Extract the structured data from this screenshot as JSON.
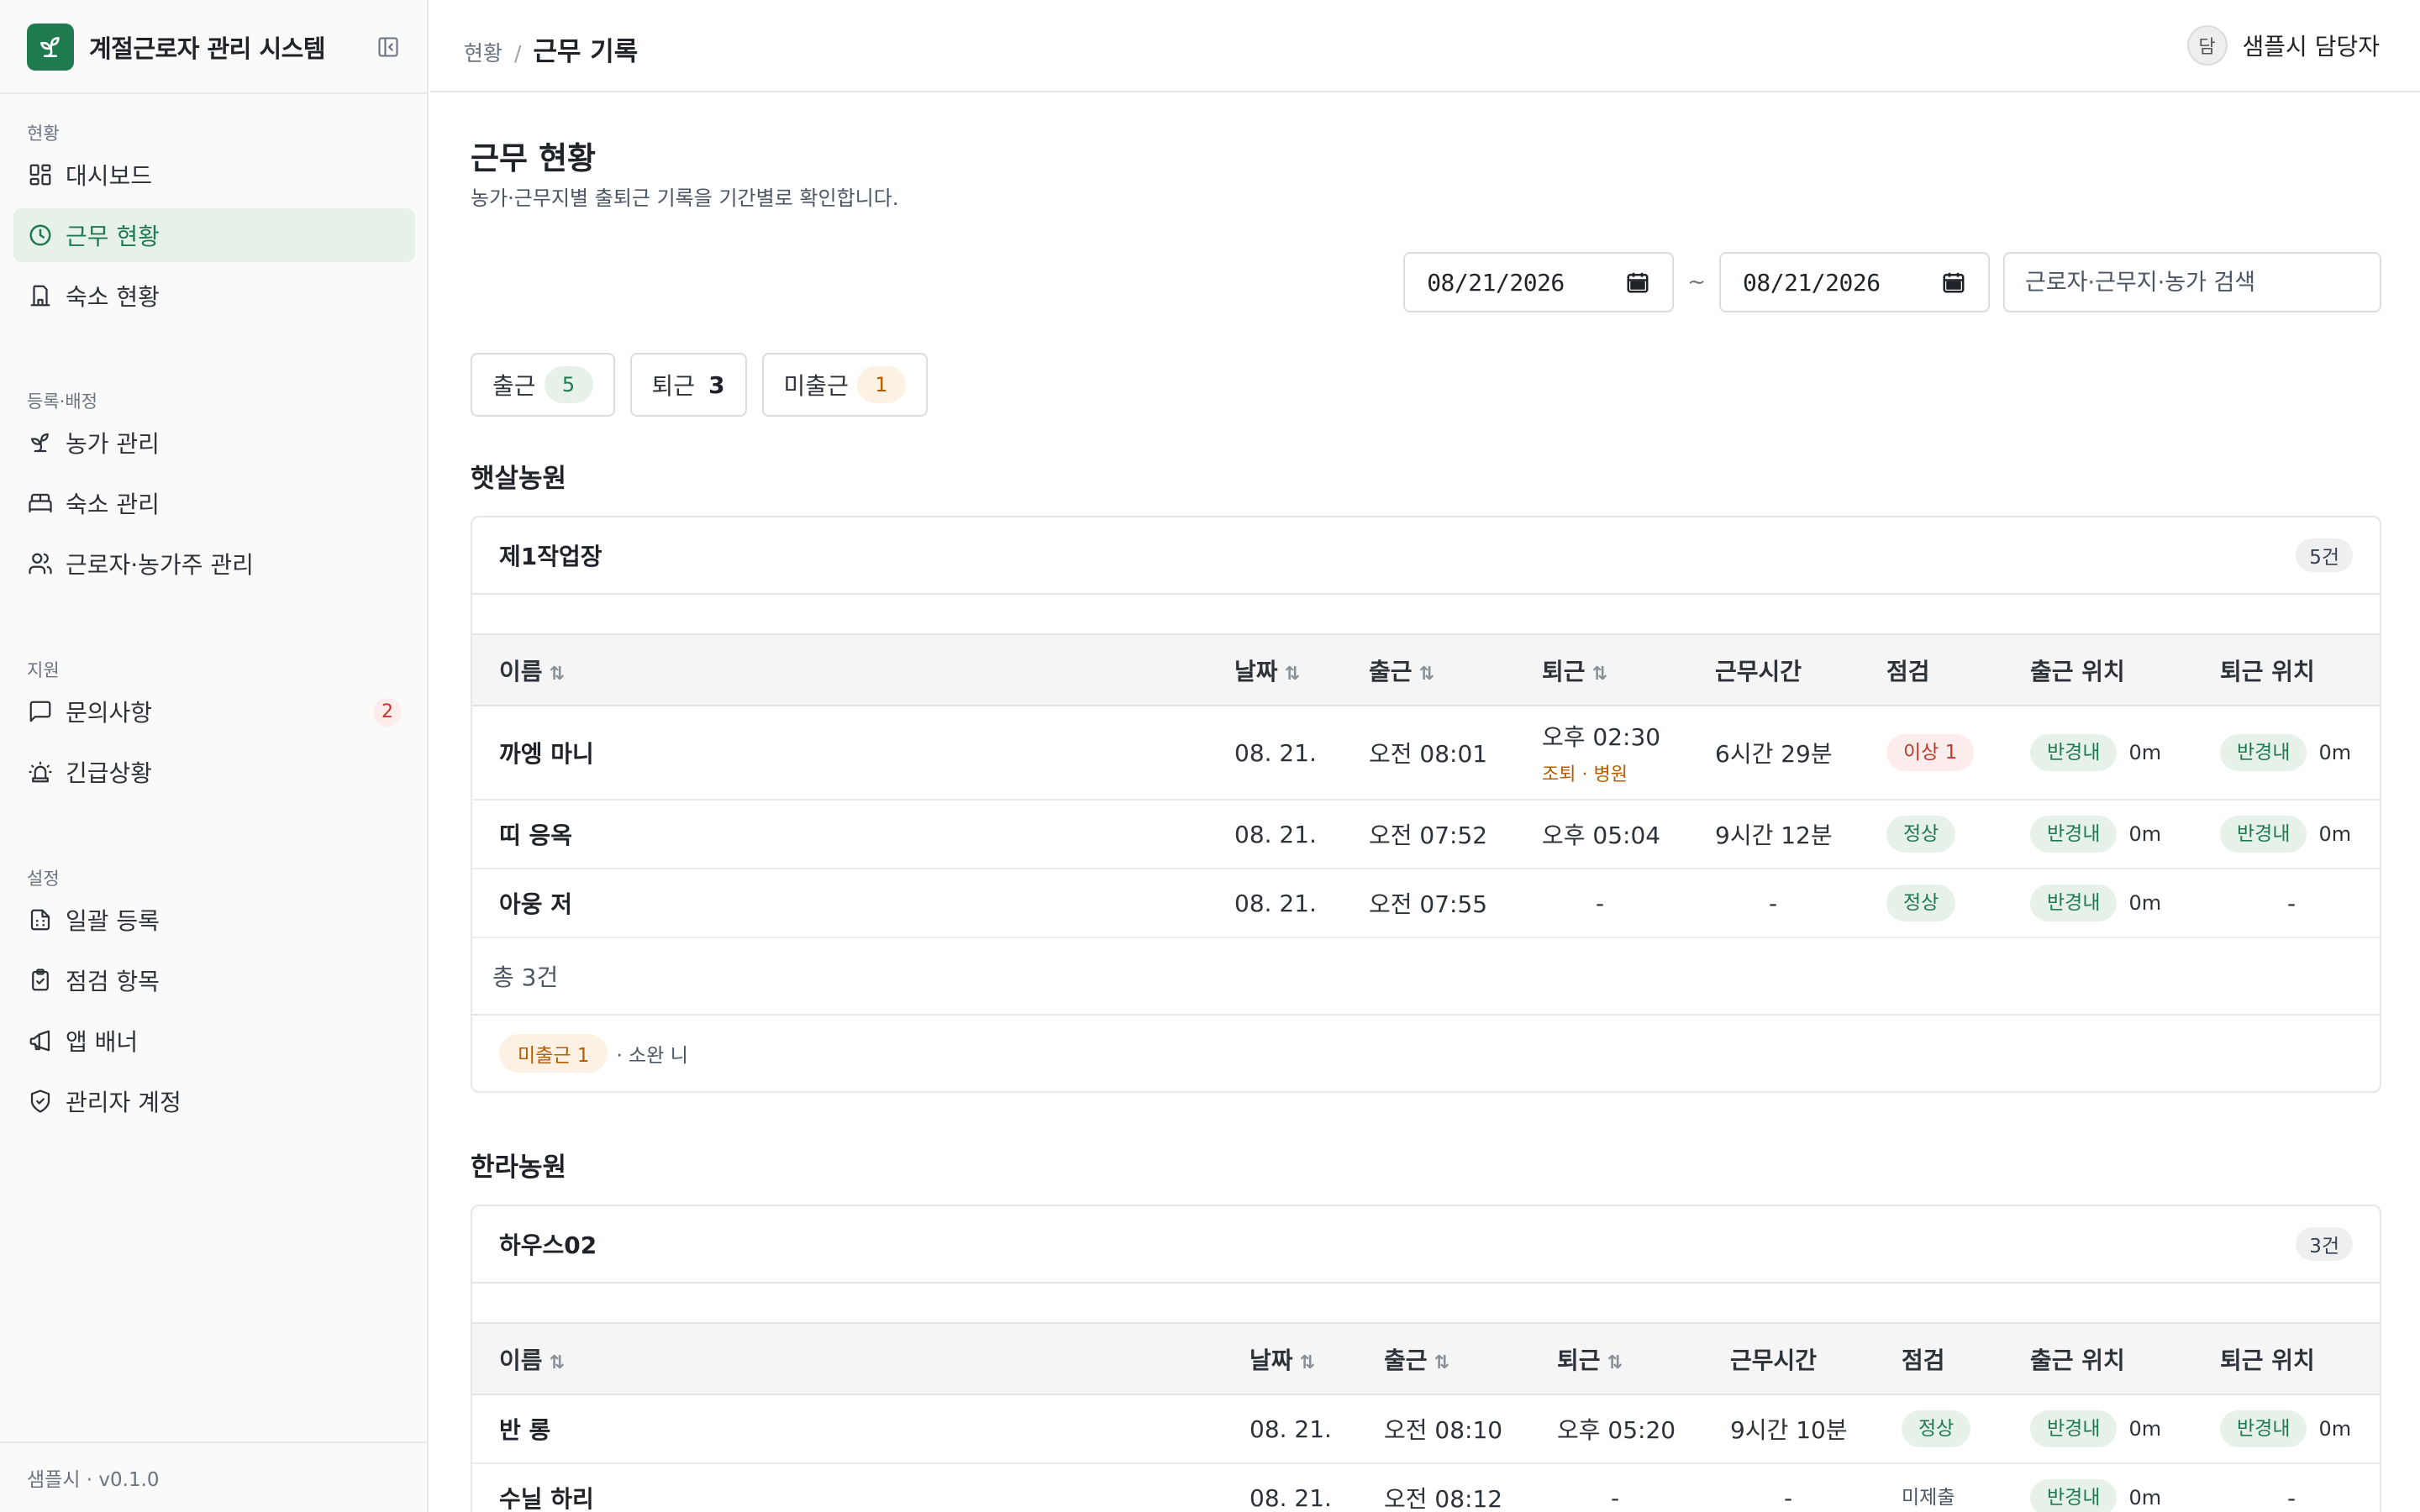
{
  "app": {
    "title": "계절근로자 관리 시스템",
    "version": "샘플시 · v0.1.0"
  },
  "sidebar": {
    "sections": [
      {
        "label": "현황",
        "items": [
          {
            "label": "대시보드",
            "icon": "dashboard-icon"
          },
          {
            "label": "근무 현황",
            "icon": "clock-icon",
            "active": true
          },
          {
            "label": "숙소 현황",
            "icon": "building-icon"
          }
        ]
      },
      {
        "label": "등록·배정",
        "items": [
          {
            "label": "농가 관리",
            "icon": "sprout-icon"
          },
          {
            "label": "숙소 관리",
            "icon": "bed-icon"
          },
          {
            "label": "근로자·농가주 관리",
            "icon": "users-icon"
          }
        ]
      },
      {
        "label": "지원",
        "items": [
          {
            "label": "문의사항",
            "icon": "message-icon",
            "badge": "2"
          },
          {
            "label": "긴급상황",
            "icon": "alarm-icon"
          }
        ]
      },
      {
        "label": "설정",
        "items": [
          {
            "label": "일괄 등록",
            "icon": "spreadsheet-icon"
          },
          {
            "label": "점검 항목",
            "icon": "clipboard-check-icon"
          },
          {
            "label": "앱 배너",
            "icon": "megaphone-icon"
          },
          {
            "label": "관리자 계정",
            "icon": "shield-check-icon"
          }
        ]
      }
    ]
  },
  "topbar": {
    "breadcrumb_parent": "현황",
    "breadcrumb_separator": "/",
    "breadcrumb_current": "근무 기록",
    "user_avatar": "담",
    "user_name": "샘플시 담당자"
  },
  "page": {
    "title": "근무 현황",
    "description": "농가·근무지별 출퇴근 기록을 기간별로 확인합니다."
  },
  "filters": {
    "start_date": "08/21/2026",
    "separator": "~",
    "end_date": "08/21/2026",
    "search_placeholder": "근로자·근무지·농가 검색"
  },
  "summary": [
    {
      "label": "출근",
      "count": "5",
      "style": "green"
    },
    {
      "label": "퇴근",
      "count": "3",
      "style": "plain"
    },
    {
      "label": "미출근",
      "count": "1",
      "style": "orange"
    }
  ],
  "columns": {
    "name": "이름",
    "date": "날짜",
    "checkin": "출근",
    "checkout": "퇴근",
    "hours": "근무시간",
    "inspection": "점검",
    "checkin_loc": "출근 위치",
    "checkout_loc": "퇴근 위치",
    "sort_glyph": "⇅"
  },
  "farms": [
    {
      "name": "햇살농원",
      "site": "제1작업장",
      "site_count": "5건",
      "rows": [
        {
          "name": "까엥 마니",
          "date": "08. 21.",
          "checkin": "오전 08:01",
          "checkout": "오후 02:30",
          "checkout_note": "조퇴 · 병원",
          "hours": "6시간 29분",
          "inspection": "이상 1",
          "inspection_status": "bad",
          "checkin_loc": "반경내",
          "checkin_dist": "0m",
          "checkout_loc": "반경내",
          "checkout_dist": "0m"
        },
        {
          "name": "띠 응옥",
          "date": "08. 21.",
          "checkin": "오전 07:52",
          "checkout": "오후 05:04",
          "hours": "9시간 12분",
          "inspection": "정상",
          "inspection_status": "ok",
          "checkin_loc": "반경내",
          "checkin_dist": "0m",
          "checkout_loc": "반경내",
          "checkout_dist": "0m"
        },
        {
          "name": "아웅 저",
          "date": "08. 21.",
          "checkin": "오전 07:55",
          "checkout": "-",
          "hours": "-",
          "inspection": "정상",
          "inspection_status": "ok",
          "checkin_loc": "반경내",
          "checkin_dist": "0m",
          "checkout_loc": "-"
        }
      ],
      "total": "총 3건",
      "absent_label": "미출근 1",
      "absent_names": "· 소완 니"
    },
    {
      "name": "한라농원",
      "site": "하우스02",
      "site_count": "3건",
      "rows": [
        {
          "name": "반 롱",
          "date": "08. 21.",
          "checkin": "오전 08:10",
          "checkout": "오후 05:20",
          "hours": "9시간 10분",
          "inspection": "정상",
          "inspection_status": "ok",
          "checkin_loc": "반경내",
          "checkin_dist": "0m",
          "checkout_loc": "반경내",
          "checkout_dist": "0m"
        },
        {
          "name": "수닐 하리",
          "date": "08. 21.",
          "checkin": "오전 08:12",
          "checkout": "-",
          "hours": "-",
          "inspection": "미제출",
          "inspection_status": "plain",
          "checkin_loc": "반경내",
          "checkin_dist": "0m",
          "checkout_loc": "-"
        }
      ]
    }
  ],
  "colors": {
    "brand": "#1f7a4f",
    "active_bg": "#e6f1ea",
    "danger": "#c0392b",
    "warning": "#b35c00"
  }
}
